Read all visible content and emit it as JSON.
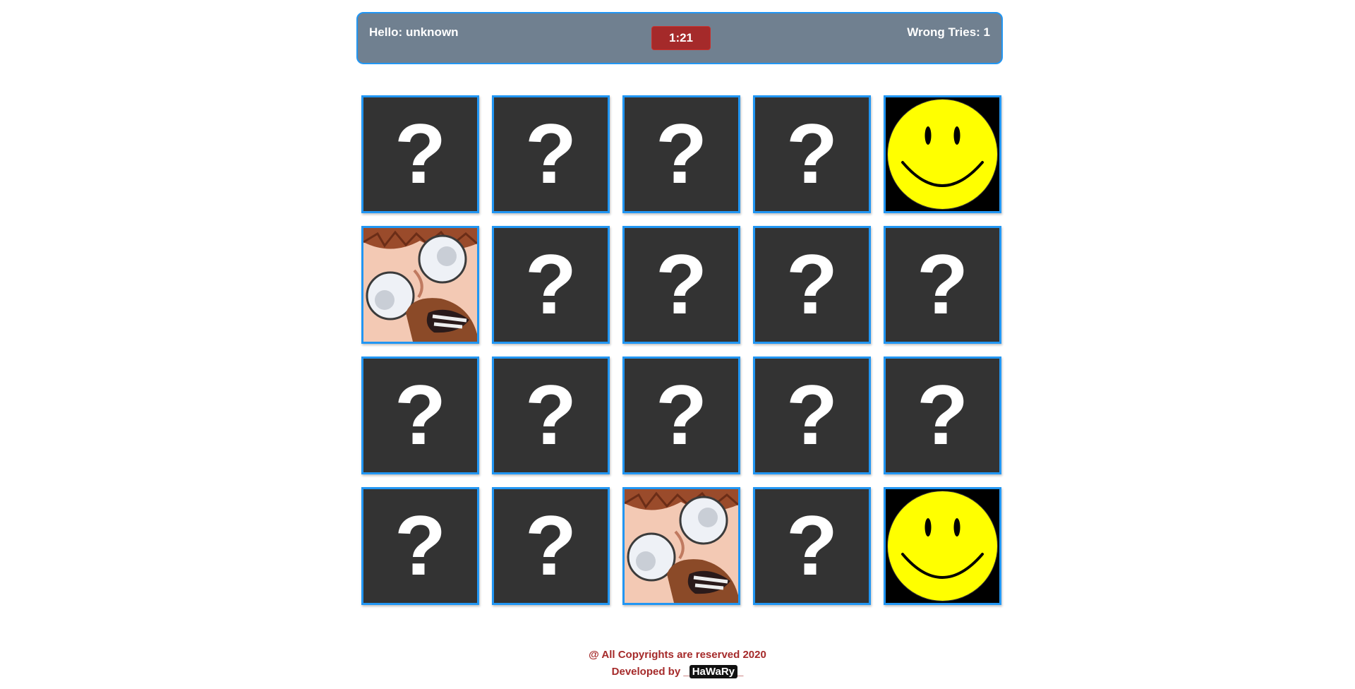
{
  "header": {
    "greeting": "Hello: unknown",
    "timer": "1:21",
    "wrong_tries": "Wrong Tries: 1"
  },
  "board": {
    "rows": 4,
    "cols": 5,
    "hidden_symbol": "?",
    "cards": [
      {
        "state": "hidden"
      },
      {
        "state": "hidden"
      },
      {
        "state": "hidden"
      },
      {
        "state": "hidden"
      },
      {
        "state": "revealed",
        "image": "smiley-face-icon"
      },
      {
        "state": "revealed",
        "image": "cartoon-face-icon"
      },
      {
        "state": "hidden"
      },
      {
        "state": "hidden"
      },
      {
        "state": "hidden"
      },
      {
        "state": "hidden"
      },
      {
        "state": "hidden"
      },
      {
        "state": "hidden"
      },
      {
        "state": "hidden"
      },
      {
        "state": "hidden"
      },
      {
        "state": "hidden"
      },
      {
        "state": "hidden"
      },
      {
        "state": "hidden"
      },
      {
        "state": "revealed",
        "image": "cartoon-face-icon"
      },
      {
        "state": "hidden"
      },
      {
        "state": "revealed",
        "image": "smiley-face-icon"
      }
    ]
  },
  "footer": {
    "copyright": "@ All Copyrights are reserved 2020",
    "developed_prefix": "Developed by _",
    "developer": "HaWaRy",
    "developed_suffix": "_"
  },
  "colors": {
    "card_border": "#2196f3",
    "card_back": "#333333",
    "header_bg": "#708090",
    "timer_bg": "#a52a2a",
    "footer_text": "#a52a2a"
  }
}
